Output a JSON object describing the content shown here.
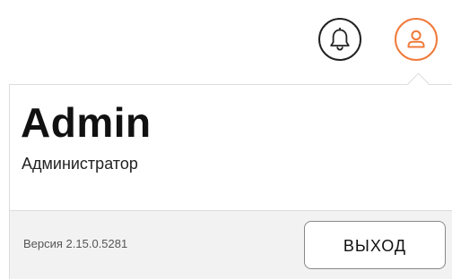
{
  "header": {
    "notifications_icon": "bell-icon",
    "profile_icon": "user-icon",
    "accent_color": "#f07a3a"
  },
  "user_menu": {
    "name": "Admin",
    "role": "Администратор",
    "version": "Версия 2.15.0.5281",
    "logout_label": "ВЫХОД"
  }
}
